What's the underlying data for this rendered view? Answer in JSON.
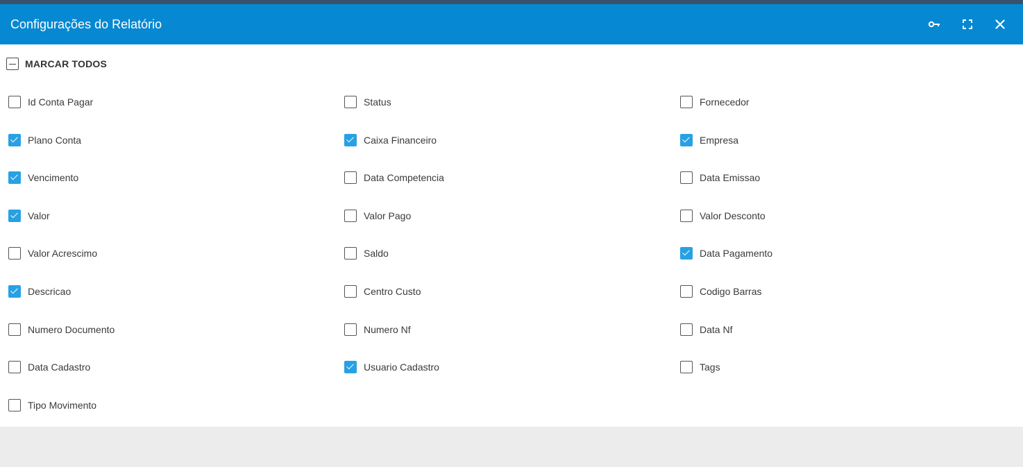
{
  "dialog": {
    "title": "Configurações do Relatório",
    "header_icons": [
      "key-icon",
      "maximize-icon",
      "close-icon"
    ],
    "colors": {
      "header_bg": "#0688d2",
      "checkbox_checked": "#27a1e4",
      "footer_bg": "#ececec"
    }
  },
  "select_all": {
    "label": "MARCAR TODOS",
    "state": "indeterminate"
  },
  "fields": [
    {
      "label": "Id Conta Pagar",
      "checked": false
    },
    {
      "label": "Status",
      "checked": false
    },
    {
      "label": "Fornecedor",
      "checked": false
    },
    {
      "label": "Plano Conta",
      "checked": true
    },
    {
      "label": "Caixa Financeiro",
      "checked": true
    },
    {
      "label": "Empresa",
      "checked": true
    },
    {
      "label": "Vencimento",
      "checked": true
    },
    {
      "label": "Data Competencia",
      "checked": false
    },
    {
      "label": "Data Emissao",
      "checked": false
    },
    {
      "label": "Valor",
      "checked": true
    },
    {
      "label": "Valor Pago",
      "checked": false
    },
    {
      "label": "Valor Desconto",
      "checked": false
    },
    {
      "label": "Valor Acrescimo",
      "checked": false
    },
    {
      "label": "Saldo",
      "checked": false
    },
    {
      "label": "Data Pagamento",
      "checked": true
    },
    {
      "label": "Descricao",
      "checked": true
    },
    {
      "label": "Centro Custo",
      "checked": false
    },
    {
      "label": "Codigo Barras",
      "checked": false
    },
    {
      "label": "Numero Documento",
      "checked": false
    },
    {
      "label": "Numero Nf",
      "checked": false
    },
    {
      "label": "Data Nf",
      "checked": false
    },
    {
      "label": "Data Cadastro",
      "checked": false
    },
    {
      "label": "Usuario Cadastro",
      "checked": true
    },
    {
      "label": "Tags",
      "checked": false
    },
    {
      "label": "Tipo Movimento",
      "checked": false
    }
  ]
}
